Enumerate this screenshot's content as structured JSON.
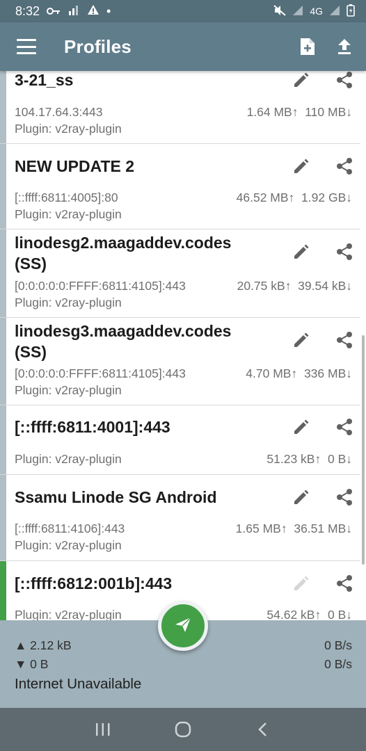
{
  "status_bar": {
    "time": "8:32",
    "dot": "•",
    "network": "4G"
  },
  "app_bar": {
    "title": "Profiles"
  },
  "profiles": [
    {
      "name": "3-21_ss",
      "server": "104.17.64.3:443",
      "upload": "1.64 MB",
      "download": "110 MB",
      "plugin": "Plugin: v2ray-plugin"
    },
    {
      "name": "NEW UPDATE 2",
      "server": "[::ffff:6811:4005]:80",
      "upload": "46.52 MB",
      "download": "1.92 GB",
      "plugin": "Plugin: v2ray-plugin"
    },
    {
      "name_line1": "linodesg2.maagaddev.codes",
      "name_line2": "(SS)",
      "server": "[0:0:0:0:0:FFFF:6811:4105]:443",
      "upload": "20.75 kB",
      "download": "39.54 kB",
      "plugin": "Plugin: v2ray-plugin"
    },
    {
      "name_line1": "linodesg3.maagaddev.codes",
      "name_line2": "(SS)",
      "server": "[0:0:0:0:0:FFFF:6811:4105]:443",
      "upload": "4.70 MB",
      "download": "336 MB",
      "plugin": "Plugin: v2ray-plugin"
    },
    {
      "name": "[::ffff:6811:4001]:443",
      "upload": "51.23 kB",
      "download": "0 B",
      "plugin": "Plugin: v2ray-plugin"
    },
    {
      "name": "Ssamu Linode SG Android",
      "server": "[::ffff:6811:4106]:443",
      "upload": "1.65 MB",
      "download": "36.51 MB",
      "plugin": "Plugin: v2ray-plugin"
    },
    {
      "name": "[::ffff:6812:001b]:443",
      "upload": "54.62 kB",
      "download": "0 B",
      "plugin": "Plugin: v2ray-plugin",
      "active": true
    }
  ],
  "arrows": {
    "up": "↑",
    "down": "↓"
  },
  "stats": {
    "tx_total": "▲ 2.12 kB",
    "rx_total": "▼ 0 B",
    "tx_rate": "0 B/s",
    "rx_rate": "0 B/s",
    "status": "Internet Unavailable"
  },
  "colors": {
    "app_bar": "#607d8b",
    "status_bar": "#546e7a",
    "accent": "#43a047",
    "inactive_bar": "#b0bec5",
    "stats_bg": "#9fb1ba"
  },
  "icons": {
    "menu": "menu-icon",
    "add_file": "add-file-icon",
    "upload": "upload-icon",
    "edit": "pencil-icon",
    "share": "share-icon",
    "connect": "paper-plane-icon",
    "recents": "recents-icon",
    "home": "home-icon",
    "back": "back-icon"
  }
}
